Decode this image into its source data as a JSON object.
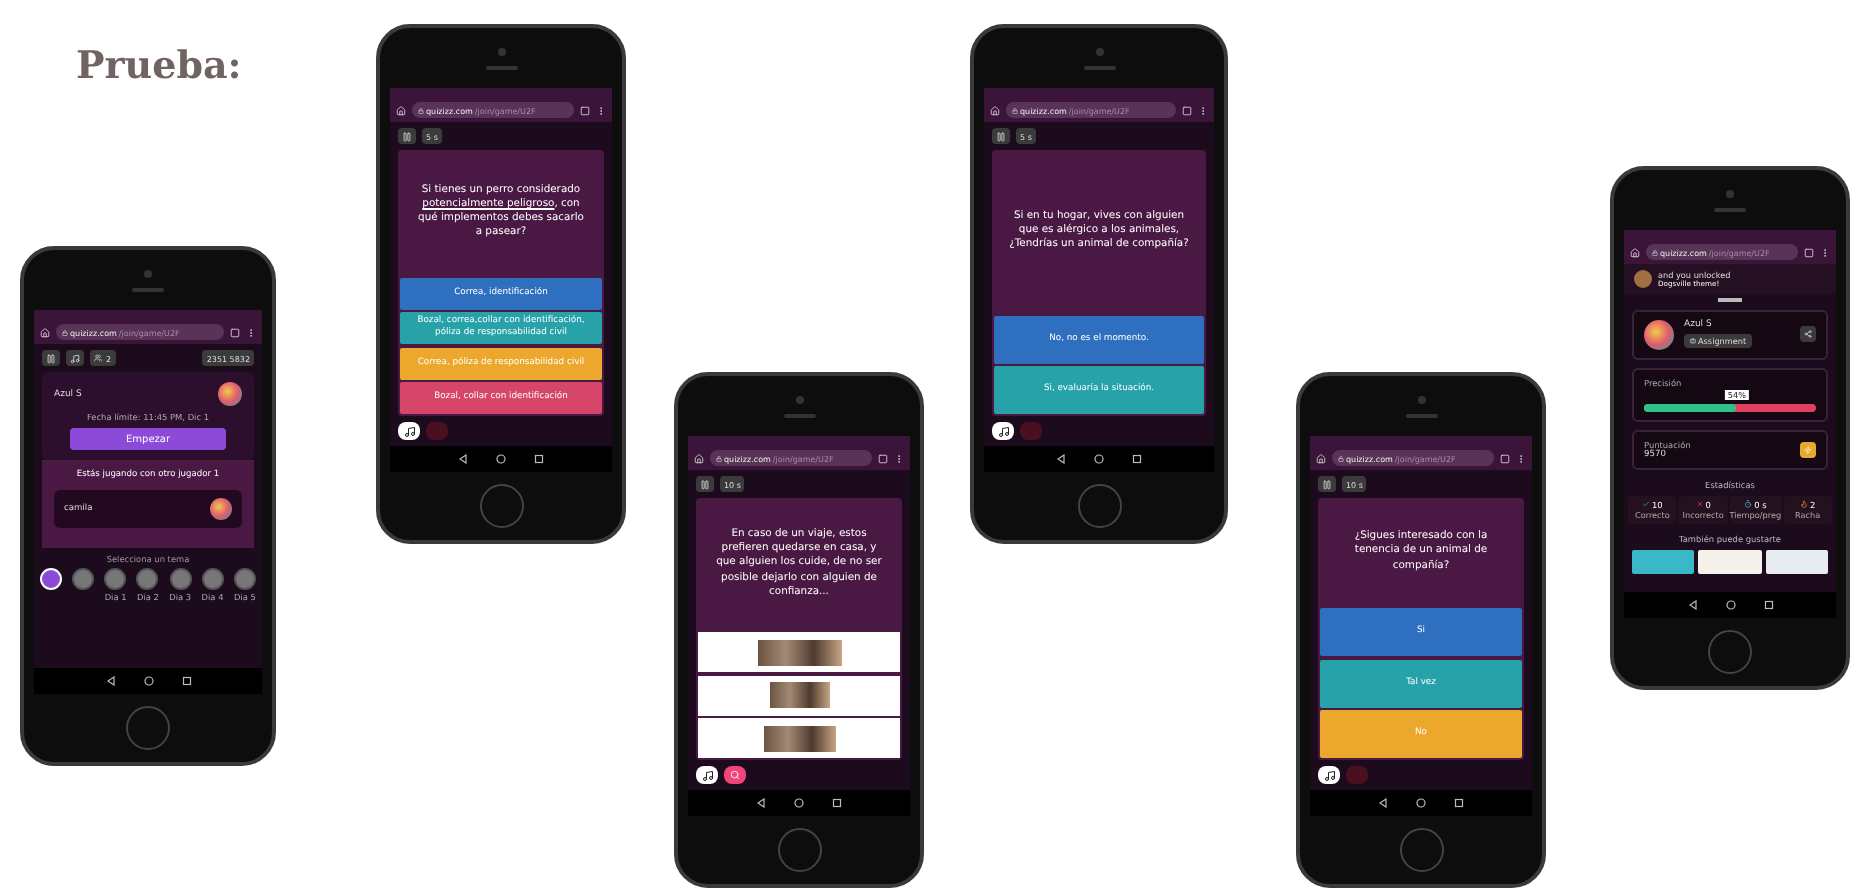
{
  "slide": {
    "title": "Prueba:"
  },
  "phones": [
    {
      "kind": "lobby",
      "url": {
        "domain": "quizizz.com",
        "path": "/join/game/U2F"
      },
      "players": "2",
      "code": "2351 5832",
      "player_name": "Azul S",
      "deadline": "Fecha límite: 11:45 PM, Dic 1",
      "start_button": "Empezar",
      "opponents_heading": "Estás jugando con otro jugador 1",
      "opponent_name": "camila",
      "themes_heading": "Selecciona un tema",
      "themes": [
        {
          "selected": true
        },
        {
          "selected": false
        },
        {
          "label": "Dia 1",
          "selected": false
        },
        {
          "label": "Dia 2",
          "selected": false
        },
        {
          "label": "Dia 3",
          "selected": false
        },
        {
          "label": "Dia 4",
          "selected": false
        },
        {
          "label": "Dia 5",
          "selected": false
        }
      ]
    },
    {
      "kind": "question",
      "url": {
        "domain": "quizizz.com",
        "path": "/join/game/U2F"
      },
      "timer": "5 s",
      "question": [
        {
          "text": "Si tienes un perro considerado ",
          "underlined": false
        },
        {
          "text": "potencialmente peligroso",
          "underlined": true
        },
        {
          "text": ", con qué implementos debes sacarlo a pasear?",
          "underlined": false
        }
      ],
      "options": [
        {
          "kind": "text",
          "text": "Correa, identificación",
          "color": "#2f6fbf"
        },
        {
          "kind": "text",
          "text": "Bozal, correa,collar con identificación, póliza de responsabilidad civil",
          "color": "#27a2a8"
        },
        {
          "kind": "text",
          "text": "Correa, póliza de responsabilidad civil",
          "color": "#eca82c"
        },
        {
          "kind": "text",
          "text": "Bozal, collar con identificación",
          "color": "#d6466a"
        }
      ],
      "powerup_active": false
    },
    {
      "kind": "question",
      "url": {
        "domain": "quizizz.com",
        "path": "/join/game/U2F"
      },
      "timer": "10 s",
      "question": [
        {
          "text": "En caso de un viaje, estos prefieren quedarse en casa, y que alguien los cuide, de no ser posible dejarlo con alguien de confianza...",
          "underlined": false
        }
      ],
      "options": [
        {
          "kind": "photo"
        },
        {
          "kind": "photo"
        },
        {
          "kind": "photo"
        }
      ],
      "powerup_active": true
    },
    {
      "kind": "question",
      "url": {
        "domain": "quizizz.com",
        "path": "/join/game/U2F"
      },
      "timer": "5 s",
      "question": [
        {
          "text": "Si en tu hogar, vives con alguien que es alérgico a los animales, ¿Tendrías un animal de compañía?",
          "underlined": false
        }
      ],
      "options": [
        {
          "kind": "text",
          "text": "No, no es el momento.",
          "color": "#2f6fbf"
        },
        {
          "kind": "text",
          "text": "Si, evaluaría la situación.",
          "color": "#27a2a8"
        }
      ],
      "powerup_active": false
    },
    {
      "kind": "question",
      "url": {
        "domain": "quizizz.com",
        "path": "/join/game/U2F"
      },
      "timer": "10 s",
      "question": [
        {
          "text": "¿Sigues interesado con la tenencia de un animal de compañía?",
          "underlined": false
        }
      ],
      "options": [
        {
          "kind": "text",
          "text": "Si",
          "color": "#2f6fbf"
        },
        {
          "kind": "text",
          "text": "Tal vez",
          "color": "#27a2a8"
        },
        {
          "kind": "text",
          "text": "No",
          "color": "#eca82c"
        }
      ],
      "powerup_active": false
    },
    {
      "kind": "results",
      "url": {
        "domain": "quizizz.com",
        "path": "/join/game/U2F"
      },
      "unlock": [
        "and you unlocked",
        "Dogsville theme!"
      ],
      "player_name": "Azul S",
      "tag": "Assignment",
      "accuracy": {
        "label": "Precisión",
        "level": 0.54,
        "reading": "54%"
      },
      "score": {
        "label": "Puntuación",
        "value": "9570"
      },
      "stats_heading": "Estadísticas",
      "stats": [
        {
          "kind": "correct",
          "value": "10",
          "label": "Correcto"
        },
        {
          "kind": "incorrect",
          "value": "0",
          "label": "Incorrecto"
        },
        {
          "kind": "time",
          "value": "0 s",
          "label": "Tiempo/preg"
        },
        {
          "kind": "streak",
          "value": "2",
          "label": "Racha"
        }
      ],
      "suggestions_heading": "También puede gustarte",
      "suggestions": [
        {
          "kind": "thumbnail"
        },
        {
          "kind": "thumbnail"
        },
        {
          "kind": "thumbnail"
        }
      ]
    }
  ]
}
